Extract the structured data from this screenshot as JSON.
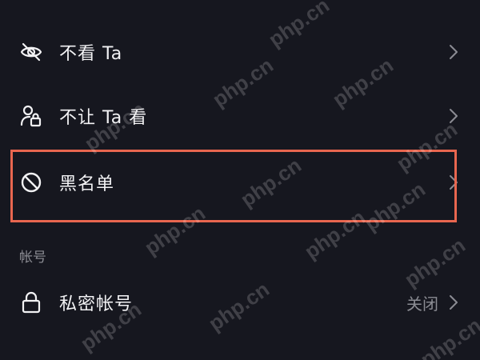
{
  "rows": [
    {
      "label": "不看 Ta",
      "icon": "eye-off-icon",
      "has_chevron": true
    },
    {
      "label": "不让 Ta 看",
      "icon": "user-lock-icon",
      "has_chevron": true
    },
    {
      "label": "黑名单",
      "icon": "block-icon",
      "has_chevron": true,
      "highlighted": true
    },
    {
      "label": "私密帐号",
      "icon": "lock-icon",
      "value": "关闭",
      "has_chevron": true
    }
  ],
  "section_header": "帐号",
  "watermark": "php.cn",
  "colors": {
    "background": "#16171f",
    "highlight_border": "#e8664f",
    "secondary_text": "#8b8c93"
  }
}
